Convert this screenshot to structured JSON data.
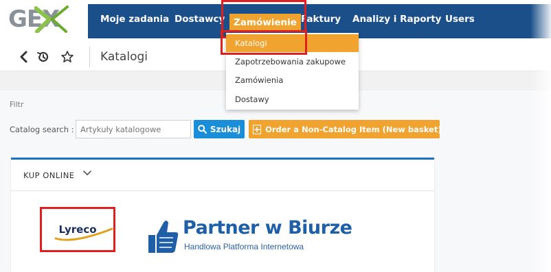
{
  "logo": {
    "text": "GEX",
    "icon": "gex-x-logo"
  },
  "nav": {
    "items": [
      {
        "label": "Moje zadania"
      },
      {
        "label": "Dostawcy"
      },
      {
        "label": "Zamówienie"
      },
      {
        "label": "Faktury"
      },
      {
        "label": "Analizy i Raporty"
      },
      {
        "label": "Users"
      }
    ],
    "active_color": "#f0a32e",
    "bar_color": "#1b4f8a"
  },
  "dropdown": {
    "items": [
      {
        "label": "Katalogi"
      },
      {
        "label": "Zapotrzebowania zakupowe"
      },
      {
        "label": "Zamówienia"
      },
      {
        "label": "Dostawy"
      }
    ]
  },
  "breadcrumb": {
    "icons": [
      "back-chevron-icon",
      "history-icon",
      "star-icon"
    ],
    "title": "Katalogi"
  },
  "filter": {
    "label": "Filtr"
  },
  "search": {
    "label": "Catalog search :",
    "placeholder": "Artykuły katalogowe",
    "button_label": "Szukaj",
    "order_button_label": "Order a Non-Catalog Item (New basket)"
  },
  "panel": {
    "title": "KUP ONLINE",
    "logos": [
      {
        "name": "Lyreco"
      },
      {
        "name": "Partner w Biurze",
        "subtitle": "Handlowa Platforma Internetowa"
      }
    ]
  },
  "colors": {
    "highlight_red": "#e0201f",
    "primary_blue": "#1a8ed8",
    "accent_orange": "#f0a32e"
  }
}
